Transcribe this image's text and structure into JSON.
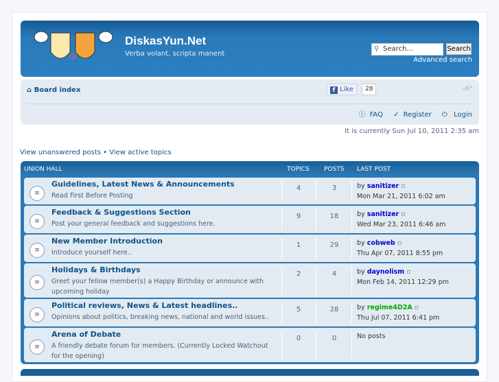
{
  "site": {
    "title": "DiskasYun.Net",
    "description": "Verba volant, scripta manent"
  },
  "search": {
    "placeholder": "Search…",
    "button": "Search",
    "advanced": "Advanced search"
  },
  "navbar": {
    "board_index": "Board index",
    "like": "Like",
    "like_count": "28",
    "font_size": "ᵥAᴬ",
    "faq": "FAQ",
    "register": "Register",
    "login": "Login"
  },
  "time": "It is currently Sun Jul 10, 2011 2:35 am",
  "quick_links": {
    "unanswered": "View unanswered posts",
    "sep": "•",
    "active": "View active topics"
  },
  "forum": {
    "headers": {
      "category": "UNION HALL",
      "topics": "TOPICS",
      "posts": "POSTS",
      "last_post": "LAST POST"
    },
    "rows": [
      {
        "title": "Guidelines, Latest News & Announcements",
        "desc": "Read First Before Posting",
        "topics": "4",
        "posts": "3",
        "by": "by",
        "user": "sanitizer",
        "user_color": "#0000cc",
        "date": "Mon Mar 21, 2011 6:02 am"
      },
      {
        "title": "Feedback & Suggestions Section",
        "desc": "Post your general feedback and suggestions here.",
        "topics": "9",
        "posts": "18",
        "by": "by",
        "user": "sanitizer",
        "user_color": "#0000cc",
        "date": "Wed Mar 23, 2011 6:46 am"
      },
      {
        "title": "New Member Introduction",
        "desc": "Introduce yourself here..",
        "topics": "1",
        "posts": "29",
        "by": "by",
        "user": "cobweb",
        "user_color": "#0000cc",
        "date": "Thu Apr 07, 2011 8:55 pm"
      },
      {
        "title": "Holidays & Birthdays",
        "desc": "Greet your fellow member(s) a Happy Birthday or announce with upcoming holiday",
        "topics": "2",
        "posts": "4",
        "by": "by",
        "user": "daynolism",
        "user_color": "#0000cc",
        "date": "Mon Feb 14, 2011 12:29 pm"
      },
      {
        "title": "Political reviews, News & Latest headlines..",
        "desc": "Opinions about politics, breaking news, national and world issues..",
        "topics": "5",
        "posts": "28",
        "by": "by",
        "user": "regime4D2A",
        "user_color": "#00aa00",
        "date": "Thu Jul 07, 2011 6:41 pm"
      },
      {
        "title": "Arena of Debate",
        "desc": "A friendly debate forum for members. (Currently Locked Watchout for the opening)",
        "topics": "0",
        "posts": "0",
        "by": "",
        "user": "",
        "user_color": "#0000cc",
        "date": "No posts"
      }
    ]
  }
}
